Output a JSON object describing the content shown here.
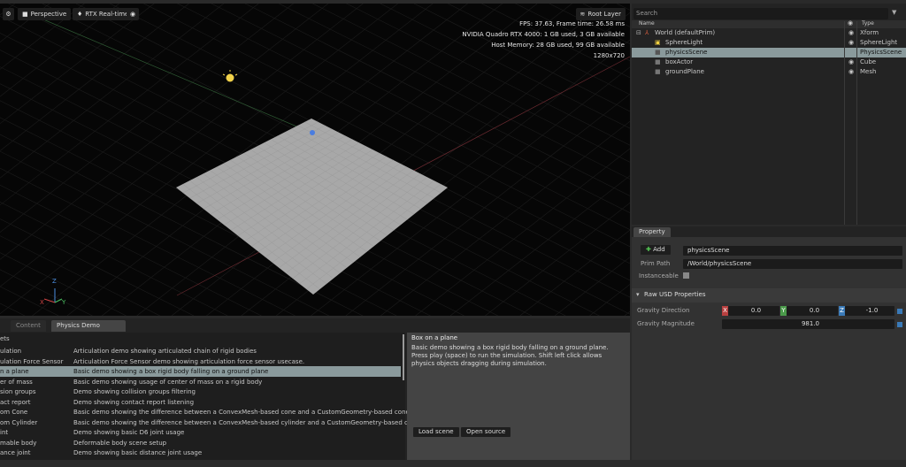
{
  "viewport": {
    "settings_icon": "gear-icon",
    "camera_label": "Perspective",
    "render_label": "RTX Real-time",
    "visibility_icon": "eye-icon",
    "layer_label": "Root Layer",
    "stats": [
      "FPS: 37.63, Frame time: 26.58 ms",
      "NVIDIA Quadro RTX 4000: 1 GB used,  3 GB available",
      "Host Memory: 28 GB used, 99 GB available",
      "1280x720"
    ],
    "axis": {
      "x": "X",
      "y": "Y",
      "z": "Z"
    }
  },
  "stage": {
    "search_placeholder": "Search",
    "col_name": "Name",
    "col_type": "Type",
    "rows": [
      {
        "name": "World (defaultPrim)",
        "type": "Xform"
      },
      {
        "name": "SphereLight",
        "type": "SphereLight"
      },
      {
        "name": "physicsScene",
        "type": "PhysicsScene"
      },
      {
        "name": "boxActor",
        "type": "Cube"
      },
      {
        "name": "groundPlane",
        "type": "Mesh"
      }
    ]
  },
  "property": {
    "tab": "Property",
    "add": "Add",
    "name_value": "physicsScene",
    "prim_path_label": "Prim Path",
    "prim_path": "/World/physicsScene",
    "instanceable_label": "Instanceable",
    "section": "Raw USD Properties",
    "gravity_dir_label": "Gravity Direction",
    "gx": "X",
    "gy": "Y",
    "gz": "Z",
    "gravity_x": "0.0",
    "gravity_y": "0.0",
    "gravity_z": "-1.0",
    "gravity_mag_label": "Gravity Magnitude",
    "gravity_mag": "981.0"
  },
  "bottom": {
    "tabs": [
      "Content",
      "Physics Demo Scenes"
    ],
    "category": "ets",
    "rows": [
      {
        "n": "ulation",
        "d": "Articulation demo showing articulated chain of rigid bodies"
      },
      {
        "n": "ulation Force Sensor",
        "d": "Articulation Force Sensor demo showing articulation force sensor usecase."
      },
      {
        "n": "n a plane",
        "d": "Basic demo showing a box rigid body falling on a ground plane"
      },
      {
        "n": "er of mass",
        "d": "Basic demo showing usage of center of mass on a rigid body"
      },
      {
        "n": "sion groups",
        "d": "Demo showing collision groups filtering"
      },
      {
        "n": "act report",
        "d": "Demo showing contact report listening"
      },
      {
        "n": "om Cone",
        "d": "Basic demo showing the difference between a ConvexMesh-based cone and a CustomGeometry-based cone"
      },
      {
        "n": "om Cylinder",
        "d": "Basic demo showing the difference between a ConvexMesh-based cylinder and a CustomGeometry-based cylinder"
      },
      {
        "n": "int",
        "d": "Demo showing basic D6 joint usage"
      },
      {
        "n": "mable body",
        "d": "Deformable body scene setup"
      },
      {
        "n": "ance joint",
        "d": "Demo showing basic distance joint usage"
      }
    ],
    "detail_title": "Box on a plane",
    "detail_text": "Basic demo showing a box rigid body falling on a ground plane. Press play (space) to run the simulation. Shift left click allows physics objects dragging during simulation.",
    "load": "Load scene",
    "open": "Open source"
  }
}
